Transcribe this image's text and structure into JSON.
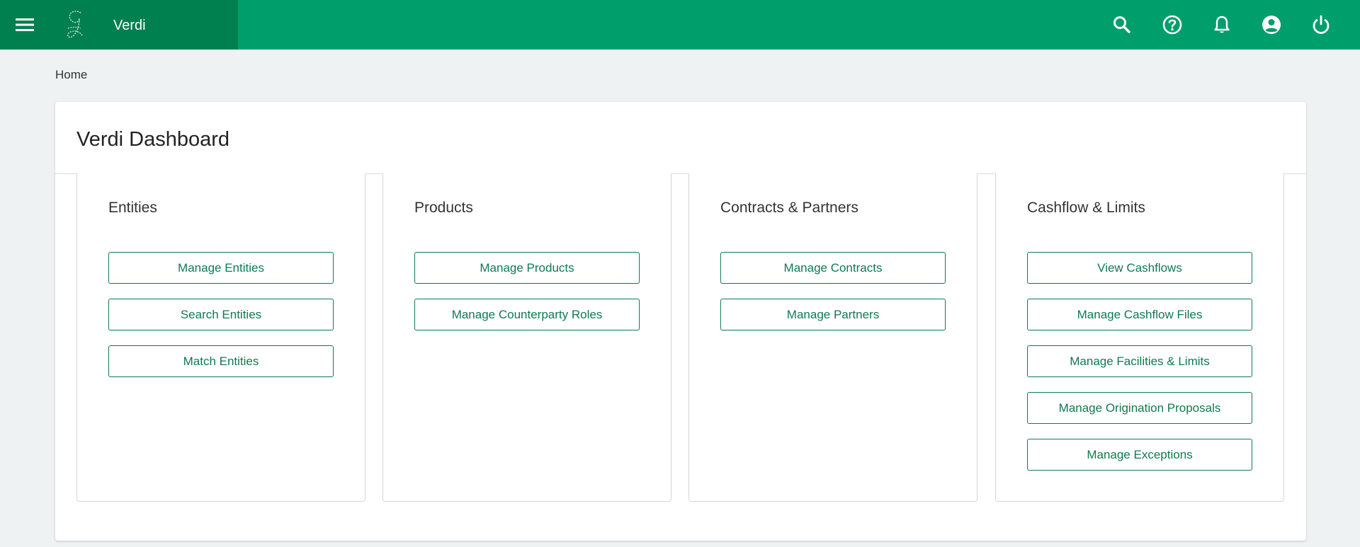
{
  "app": {
    "name": "Verdi",
    "colors": {
      "topbar": "#009e6a",
      "brand_block": "#007f4f",
      "accent": "#0f7a4f"
    }
  },
  "topbar_icons": [
    "search-icon",
    "help-icon",
    "notifications-icon",
    "account-icon",
    "power-icon"
  ],
  "breadcrumb": {
    "home": "Home"
  },
  "dashboard": {
    "title": "Verdi Dashboard",
    "sections": [
      {
        "title": "Entities",
        "buttons": [
          "Manage Entities",
          "Search Entities",
          "Match Entities"
        ]
      },
      {
        "title": "Products",
        "buttons": [
          "Manage Products",
          "Manage Counterparty Roles"
        ]
      },
      {
        "title": "Contracts & Partners",
        "buttons": [
          "Manage Contracts",
          "Manage Partners"
        ]
      },
      {
        "title": "Cashflow & Limits",
        "buttons": [
          "View Cashflows",
          "Manage Cashflow Files",
          "Manage Facilities & Limits",
          "Manage Origination Proposals",
          "Manage Exceptions"
        ]
      }
    ]
  }
}
